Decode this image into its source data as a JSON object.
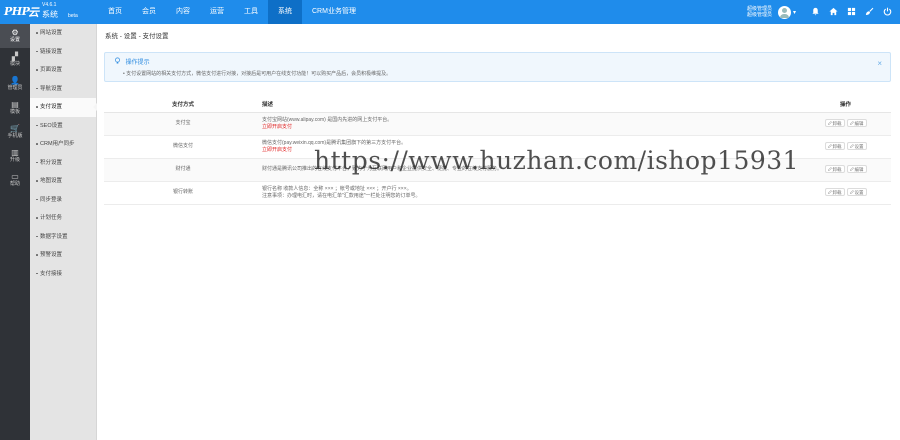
{
  "app": {
    "logo_php": "PHP",
    "logo_yun": "云",
    "version": "V4.6.1",
    "system_name": "系统",
    "beta": "beta"
  },
  "topnav": [
    {
      "label": "首页",
      "active": false
    },
    {
      "label": "会员",
      "active": false
    },
    {
      "label": "内容",
      "active": false
    },
    {
      "label": "运营",
      "active": false
    },
    {
      "label": "工具",
      "active": false
    },
    {
      "label": "系统",
      "active": true
    },
    {
      "label": "CRM业务管理",
      "active": false
    }
  ],
  "topright": {
    "admin_line1": "超级管理员",
    "admin_line2": "超级管理员",
    "caret": "▾",
    "icons": [
      "notification-icon",
      "home-icon",
      "apps-icon",
      "clean-icon",
      "power-icon"
    ]
  },
  "leftbar": [
    {
      "label": "设置",
      "icon": "gear-icon",
      "glyph": "⚙",
      "active": true
    },
    {
      "label": "模块",
      "icon": "modules-icon",
      "glyph": "▞",
      "active": false
    },
    {
      "label": "管理员",
      "icon": "admin-icon",
      "glyph": "👤",
      "active": false
    },
    {
      "label": "模板",
      "icon": "template-icon",
      "glyph": "▤",
      "active": false
    },
    {
      "label": "手机版",
      "icon": "mobile-icon",
      "glyph": "🛒",
      "active": false
    },
    {
      "label": "升级",
      "icon": "upgrade-icon",
      "glyph": "▥",
      "active": false
    },
    {
      "label": "帮助",
      "icon": "help-icon",
      "glyph": "▭",
      "active": false
    }
  ],
  "submenu": [
    {
      "label": "网站设置",
      "active": false
    },
    {
      "label": "链接设置",
      "active": false
    },
    {
      "label": "页面设置",
      "active": false
    },
    {
      "label": "导航设置",
      "active": false
    },
    {
      "label": "支付设置",
      "active": true
    },
    {
      "label": "SEO设置",
      "active": false
    },
    {
      "label": "CRM用户同步",
      "active": false
    },
    {
      "label": "积分设置",
      "active": false
    },
    {
      "label": "地图设置",
      "active": false
    },
    {
      "label": "同步登录",
      "active": false
    },
    {
      "label": "计划任务",
      "active": false
    },
    {
      "label": "数据字设置",
      "active": false
    },
    {
      "label": "预警设置",
      "active": false
    },
    {
      "label": "支付接接",
      "active": false
    }
  ],
  "breadcrumb": "系统 - 设置 - 支付设置",
  "tips": {
    "title": "操作提示",
    "text": "• 支付设置网站的相关支付方式，微信支付进行对接，对接后是可用户在线支付功能！可以购买产品后，会员积极维提及。",
    "close": "×"
  },
  "table": {
    "headers": {
      "name": "支付方式",
      "desc": "描述",
      "ops": "操作"
    },
    "rows": [
      {
        "name": "支付宝",
        "desc": "支付宝网站(www.alipay.com) 是国内先进的网上支付平台。",
        "link": "立即开启支付",
        "ops": [
          {
            "label": "卸载",
            "icon": "edit-icon"
          },
          {
            "label": "编辑",
            "icon": "settings-icon"
          }
        ]
      },
      {
        "name": "微信支付",
        "desc": "微信支付(pay.weixin.qq.com)是腾讯集团旗下的第三方支付平台。",
        "link": "立即开启支付",
        "ops": [
          {
            "label": "卸载",
            "icon": "edit-icon"
          },
          {
            "label": "设置",
            "icon": "settings-icon"
          }
        ]
      },
      {
        "name": "财付通",
        "desc": "财付通是腾讯公司推出的在线支付平台，致力于为互联网用户和企业提供安全、便捷、专业的在线支付服务。",
        "link": "",
        "ops": [
          {
            "label": "卸载",
            "icon": "edit-icon"
          },
          {
            "label": "编辑",
            "icon": "settings-icon"
          }
        ]
      },
      {
        "name": "银行转账",
        "desc": "银行名称 收款人信息：全称 ××× ；帐号或地址 ××× ；开户行 ×××。",
        "desc2": "注意事项：办理电汇时，请在电汇单\"汇款用途\"一栏处注明您的订单号。",
        "link": "",
        "ops": [
          {
            "label": "卸载",
            "icon": "edit-icon"
          },
          {
            "label": "设置",
            "icon": "settings-icon"
          }
        ]
      }
    ]
  },
  "watermark": "https://www.huzhan.com/ishop15931"
}
